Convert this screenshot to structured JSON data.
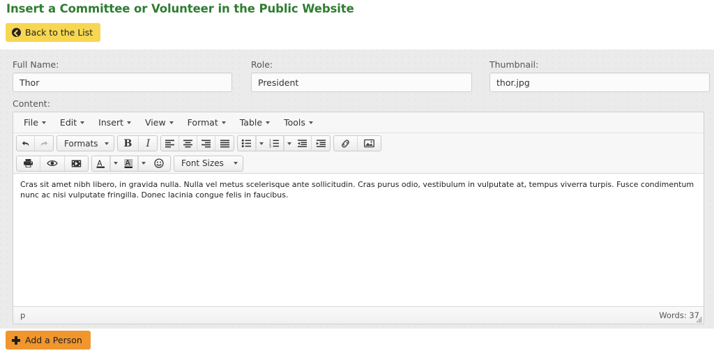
{
  "header": {
    "title": "Insert a Committee or Volunteer in the Public Website",
    "title_color": "#2f7d32",
    "back_button": {
      "label": "Back to the List",
      "icon": "arrow-circle-left-icon",
      "bg": "#f7d751"
    }
  },
  "form": {
    "fields": [
      {
        "label": "Full Name:",
        "value": "Thor",
        "placeholder": "Full Name"
      },
      {
        "label": "Role:",
        "value": "President",
        "placeholder": "Role"
      },
      {
        "label": "Thumbnail:",
        "value": "thor.jpg",
        "placeholder": "Thumbnail"
      }
    ],
    "content_label": "Content:"
  },
  "editor": {
    "menubar": [
      {
        "label": "File"
      },
      {
        "label": "Edit"
      },
      {
        "label": "Insert"
      },
      {
        "label": "View"
      },
      {
        "label": "Format"
      },
      {
        "label": "Table"
      },
      {
        "label": "Tools"
      }
    ],
    "toolbar_row1": {
      "undo": "undo-icon",
      "redo": "redo-icon",
      "formats_label": "Formats",
      "bold": "B",
      "italic": "I",
      "align_left": "align-left-icon",
      "align_center": "align-center-icon",
      "align_right": "align-right-icon",
      "align_justify": "align-justify-icon",
      "bullist": "bullet-list-icon",
      "numlist": "numbered-list-icon",
      "outdent": "outdent-icon",
      "indent": "indent-icon",
      "link": "link-icon",
      "image": "image-icon"
    },
    "toolbar_row2": {
      "print": "print-icon",
      "preview": "preview-eye-icon",
      "media": "media-icon",
      "forecolor": "text-color-icon",
      "backcolor": "background-color-icon",
      "emoticons": "emoticon-icon",
      "fontsizes_label": "Font Sizes"
    },
    "content": "Cras sit amet nibh libero, in gravida nulla. Nulla vel metus scelerisque ante sollicitudin. Cras purus odio, vestibulum in vulputate at, tempus viverra turpis. Fusce condimentum nunc ac nisi vulputate fringilla. Donec lacinia congue felis in faucibus.",
    "statusbar": {
      "path": "p",
      "words": "Words: 37"
    }
  },
  "footer": {
    "add_button": {
      "label": "Add a Person",
      "icon": "plus-icon",
      "bg": "#f0962d"
    }
  }
}
